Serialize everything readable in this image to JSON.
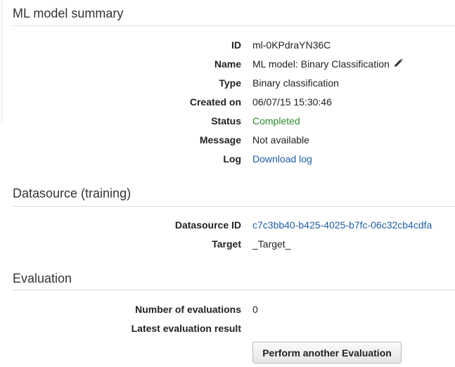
{
  "summary": {
    "title": "ML model summary",
    "fields": [
      {
        "label": "ID",
        "value": "ml-0KPdraYN36C"
      },
      {
        "label": "Name",
        "value": "ML model: Binary Classification"
      },
      {
        "label": "Type",
        "value": "Binary classification"
      },
      {
        "label": "Created on",
        "value": "06/07/15 15:30:46"
      },
      {
        "label": "Status",
        "value": "Completed"
      },
      {
        "label": "Message",
        "value": "Not available"
      },
      {
        "label": "Log",
        "value": "Download log"
      }
    ]
  },
  "datasource": {
    "title": "Datasource (training)",
    "fields": [
      {
        "label": "Datasource ID",
        "value": "c7c3bb40-b425-4025-b7fc-06c32cb4cdfa"
      },
      {
        "label": "Target",
        "value": "_Target_"
      }
    ]
  },
  "evaluation": {
    "title": "Evaluation",
    "fields": [
      {
        "label": "Number of evaluations",
        "value": "0"
      },
      {
        "label": "Latest evaluation result",
        "value": ""
      }
    ],
    "button_label": "Perform another Evaluation"
  },
  "colors": {
    "link": "#1f5ea8",
    "status_completed": "#2d8a2d",
    "divider": "#dddddd"
  },
  "icons": {
    "name_edit": "pencil-icon"
  }
}
